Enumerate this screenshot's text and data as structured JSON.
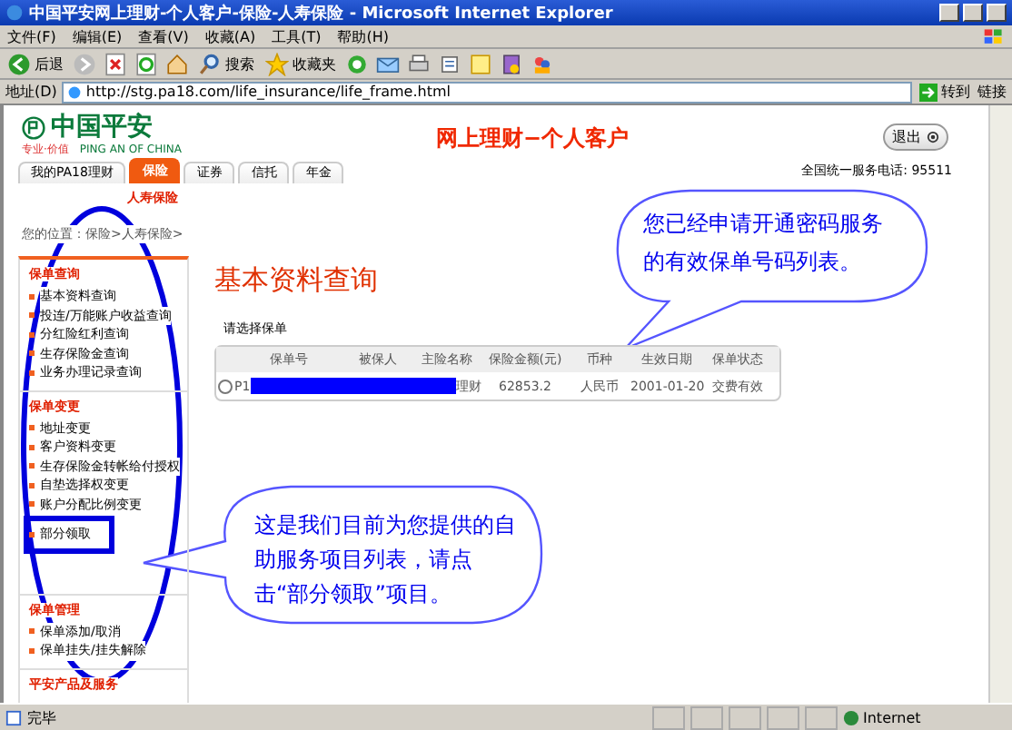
{
  "window": {
    "title": "中国平安网上理财-个人客户-保险-人寿保险 - Microsoft Internet Explorer"
  },
  "menu": [
    "文件(F)",
    "编辑(E)",
    "查看(V)",
    "收藏(A)",
    "工具(T)",
    "帮助(H)"
  ],
  "toolbar": [
    {
      "kind": "back",
      "label": "后退"
    },
    {
      "kind": "forward"
    },
    {
      "kind": "stop"
    },
    {
      "kind": "refresh"
    },
    {
      "kind": "home"
    },
    {
      "kind": "search",
      "label": "搜索"
    },
    {
      "kind": "favorites",
      "label": "收藏夹"
    },
    {
      "kind": "media"
    },
    {
      "kind": "mail"
    },
    {
      "kind": "print"
    },
    {
      "kind": "edit"
    },
    {
      "kind": "note"
    },
    {
      "kind": "research"
    },
    {
      "kind": "messenger"
    }
  ],
  "address_bar": {
    "label": "地址(D)",
    "value": "http://stg.pa18.com/life_insurance/life_frame.html",
    "go": "转到",
    "links": "链接"
  },
  "site": {
    "logo_cn": "中国平安",
    "logo_tagline": "专业·价值",
    "logo_en": "PING AN OF CHINA",
    "title": "网上理财−个人客户",
    "exit": "退出",
    "hotline": "全国统一服务电话: 95511"
  },
  "tabs": [
    {
      "label": "我的PA18理财",
      "selected": false
    },
    {
      "label": "保险",
      "selected": true
    },
    {
      "label": "证券",
      "selected": false
    },
    {
      "label": "信托",
      "selected": false
    },
    {
      "label": "年金",
      "selected": false
    }
  ],
  "subtab": "人寿保险",
  "breadcrumb": "您的位置：保险>人寿保险>",
  "sidebar": [
    {
      "title": "保单查询",
      "items": [
        {
          "label": "基本资料查询",
          "highlighted": false
        },
        {
          "label": "投连/万能账户收益查询",
          "highlighted": false
        },
        {
          "label": "分红险红利查询",
          "highlighted": false
        },
        {
          "label": "生存保险金查询",
          "highlighted": false
        },
        {
          "label": "业务办理记录查询",
          "highlighted": false
        }
      ]
    },
    {
      "title": "保单变更",
      "items": [
        {
          "label": "地址变更",
          "highlighted": false
        },
        {
          "label": "客户资料变更",
          "highlighted": false
        },
        {
          "label": "生存保险金转帐给付授权",
          "highlighted": false
        },
        {
          "label": "自垫选择权变更",
          "highlighted": false
        },
        {
          "label": "账户分配比例变更",
          "highlighted": false
        },
        {
          "label": "部分领取",
          "highlighted": true
        }
      ]
    },
    {
      "title": "保单管理",
      "items": [
        {
          "label": "保单添加/取消",
          "highlighted": false
        },
        {
          "label": "保单挂失/挂失解除",
          "highlighted": false
        }
      ]
    },
    {
      "title": "平安产品及服务"
    }
  ],
  "main": {
    "heading": "基本资料查询",
    "prompt": "请选择保单",
    "table": {
      "columns": [
        "保单号",
        "被保人",
        "主险名称",
        "保险金额(元)",
        "币种",
        "生效日期",
        "保单状态"
      ],
      "rows": [
        {
          "selected": false,
          "cells": [
            {
              "text": "P1",
              "redacted": true
            },
            {
              "redacted": true
            },
            {
              "text": "理财",
              "redacted": true
            },
            {
              "text": "62853.2",
              "redacted": false
            },
            {
              "text": "人民币",
              "redacted": false
            },
            {
              "text": "2001-01-20",
              "redacted": false
            },
            {
              "text": "交费有效",
              "redacted": false
            }
          ]
        }
      ]
    }
  },
  "callouts": [
    {
      "text": "您已经申请开通密码服务的有效保单号码列表。"
    },
    {
      "text": "这是我们目前为您提供的自助服务项目列表，请点击“部分领取”项目。"
    }
  ],
  "status_bar": {
    "text": "完毕",
    "zone": "Internet"
  }
}
